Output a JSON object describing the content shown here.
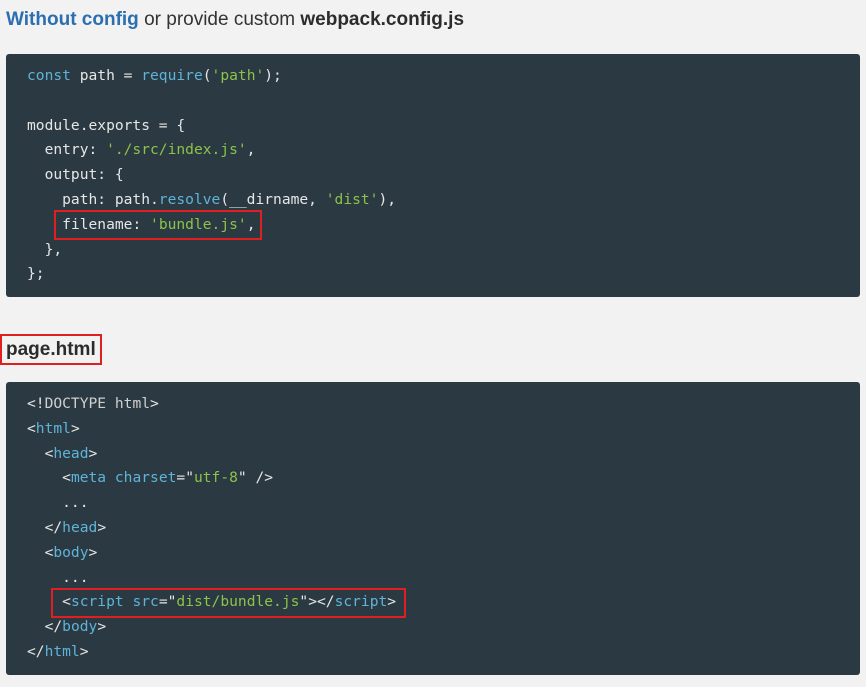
{
  "intro": {
    "link_text": "Without config",
    "middle_text": " or provide custom ",
    "filename": "webpack.config.js"
  },
  "config_code": {
    "l1_kw": "const",
    "l1_rest": " path = ",
    "l1_fn": "require",
    "l1_p1": "(",
    "l1_str": "'path'",
    "l1_p2": ");",
    "l3": "module.exports = {",
    "l4_key": "  entry: ",
    "l4_str": "'./src/index.js'",
    "l4_end": ",",
    "l5": "  output: {",
    "l6_a": "    path: path.",
    "l6_fn": "resolve",
    "l6_b": "(__dirname, ",
    "l6_str": "'dist'",
    "l6_end": "),",
    "l7_indent": "    ",
    "l7_key": "filename: ",
    "l7_str": "'bundle.js'",
    "l7_end": ",",
    "l8": "  },",
    "l9": "};"
  },
  "page_heading": "page.html",
  "html_code": {
    "l1_a": "<!",
    "l1_doc": "DOCTYPE html",
    "l1_b": ">",
    "l2_a": "<",
    "l2_tag": "html",
    "l2_b": ">",
    "l3_a": "  <",
    "l3_tag": "head",
    "l3_b": ">",
    "l4_a": "    <",
    "l4_tag": "meta",
    "l4_sp": " ",
    "l4_attr": "charset",
    "l4_eq": "=\"",
    "l4_str": "utf-8",
    "l4_end": "\" />",
    "l5": "    ...",
    "l6_a": "  </",
    "l6_tag": "head",
    "l6_b": ">",
    "l7_a": "  <",
    "l7_tag": "body",
    "l7_b": ">",
    "l8": "    ...",
    "l9_indent": "    ",
    "l9_a": "<",
    "l9_tag": "script",
    "l9_sp": " ",
    "l9_attr": "src",
    "l9_eq": "=\"",
    "l9_str": "dist/bundle.js",
    "l9_mid": "\"></",
    "l9_tag2": "script",
    "l9_b": ">",
    "l10_a": "  </",
    "l10_tag": "body",
    "l10_b": ">",
    "l11_a": "</",
    "l11_tag": "html",
    "l11_b": ">"
  },
  "colors": {
    "background": "#f2f2f2",
    "code_background": "#2b3a42",
    "link": "#2b6fb0",
    "keyword": "#5fb3d9",
    "string": "#8bc34a",
    "highlight_border": "#e02020"
  }
}
